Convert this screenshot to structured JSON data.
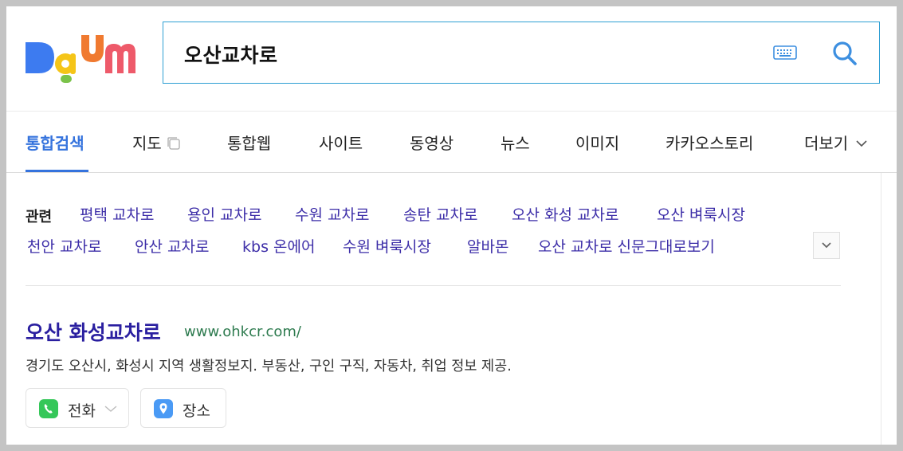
{
  "search": {
    "query": "오산교차로"
  },
  "tabs": [
    {
      "label": "통합검색"
    },
    {
      "label": "지도"
    },
    {
      "label": "통합웹"
    },
    {
      "label": "사이트"
    },
    {
      "label": "동영상"
    },
    {
      "label": "뉴스"
    },
    {
      "label": "이미지"
    },
    {
      "label": "카카오스토리"
    },
    {
      "label": "더보기"
    }
  ],
  "related": {
    "heading": "관련",
    "items": [
      "평택 교차로",
      "용인 교차로",
      "수원 교차로",
      "송탄 교차로",
      "오산 화성 교차로",
      "오산 벼룩시장",
      "천안 교차로",
      "안산 교차로",
      "kbs 온에어",
      "수원 벼룩시장",
      "알바몬",
      "오산 교차로 신문그대로보기"
    ]
  },
  "result": {
    "title": "오산 화성교차로",
    "url": "www.ohkcr.com/",
    "description": "경기도 오산시, 화성시 지역 생활정보지. 부동산, 구인 구직, 자동차, 취업 정보 제공.",
    "chips": {
      "phone": "전화",
      "place": "장소"
    }
  },
  "colors": {
    "accent": "#3573dd",
    "link": "#3d2ea8",
    "url": "#2e7b4f",
    "search_border": "#2e9fd3",
    "phone_green": "#35c759",
    "place_blue": "#4a9af5"
  },
  "icons": {
    "logo": "daum-logo",
    "keyboard": "keyboard-icon",
    "search": "search-icon",
    "map_external": "external-window-icon",
    "more": "chevron-down-icon"
  }
}
